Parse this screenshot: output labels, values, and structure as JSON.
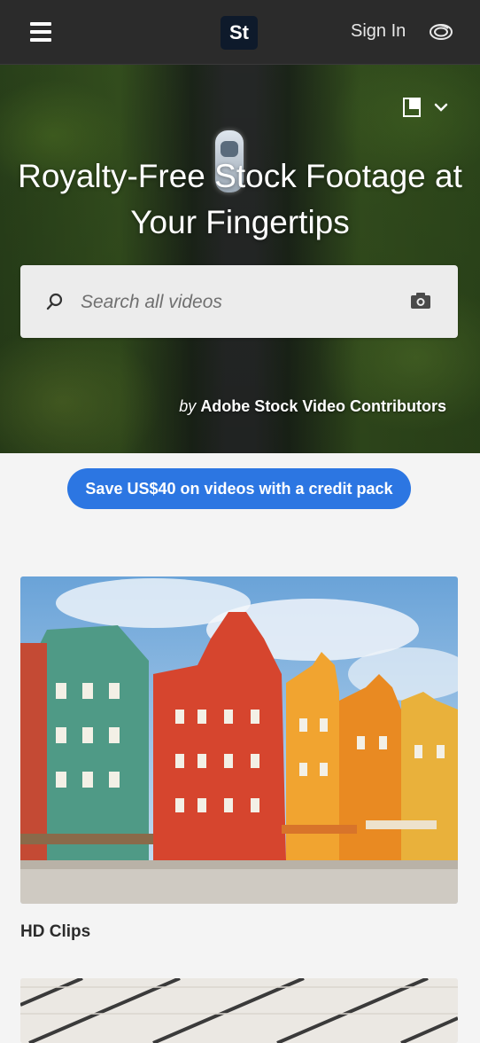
{
  "header": {
    "logo_text": "St",
    "sign_in_label": "Sign In",
    "menu_icon": "hamburger-menu-icon",
    "cloud_icon": "creative-cloud-icon"
  },
  "hero": {
    "title": "Royalty-Free Stock Footage at Your Fingertips",
    "search": {
      "placeholder": "Search all videos",
      "value": ""
    },
    "credit_by": "by",
    "credit_name": "Adobe Stock Video Contributors",
    "tools_icon": "asset-type-selector-icon"
  },
  "promo": {
    "label": "Save US$40 on videos with a credit pack",
    "color": "#2c76e2"
  },
  "categories": [
    {
      "label": "HD Clips"
    },
    {
      "label": ""
    }
  ]
}
